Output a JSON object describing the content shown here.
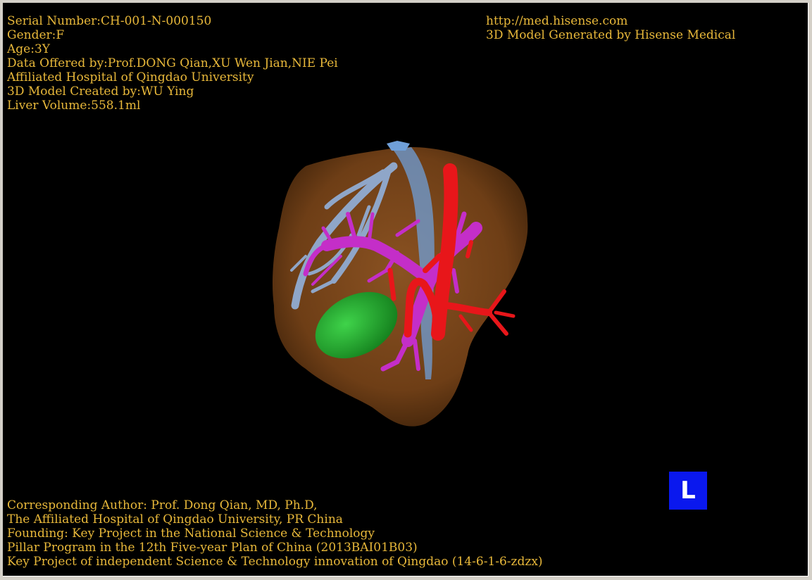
{
  "patient_info": {
    "serial_number": "Serial Number:CH-001-N-000150",
    "gender": "Gender:F",
    "age": "Age:3Y",
    "data_offered_by": "Data Offered by:Prof.DONG Qian,XU Wen Jian,NIE Pei",
    "hospital": "Affiliated Hospital of Qingdao University",
    "model_created_by": "3D Model Created by:WU Ying",
    "liver_volume": "Liver Volume:558.1ml"
  },
  "site_info": {
    "url": "http://med.hisense.com",
    "generator": "3D Model Generated by Hisense Medical"
  },
  "credits": {
    "corresponding_author": "Corresponding Author: Prof. Dong Qian, MD, Ph.D,",
    "affiliation": "The Affiliated Hospital of Qingdao University, PR China",
    "founding": "Founding: Key Project in the National Science & Technology",
    "pillar_program": "Pillar Program in the 12th Five-year Plan of China (2013BAI01B03)",
    "key_project": "Key Project of independent Science & Technology innovation of Qingdao (14-6-1-6-zdzx)"
  },
  "orientation_marker": {
    "label": "L",
    "color": "#0a18ee"
  },
  "colors": {
    "text": "#e8b83a",
    "background": "#000000",
    "liver": "#6e3e16",
    "hepatic_vein": "#8fa6c8",
    "portal_vein": "#c42ec8",
    "artery": "#e8161a",
    "gallbladder": "#1fa52a",
    "ivc": "#6f9fd8"
  }
}
